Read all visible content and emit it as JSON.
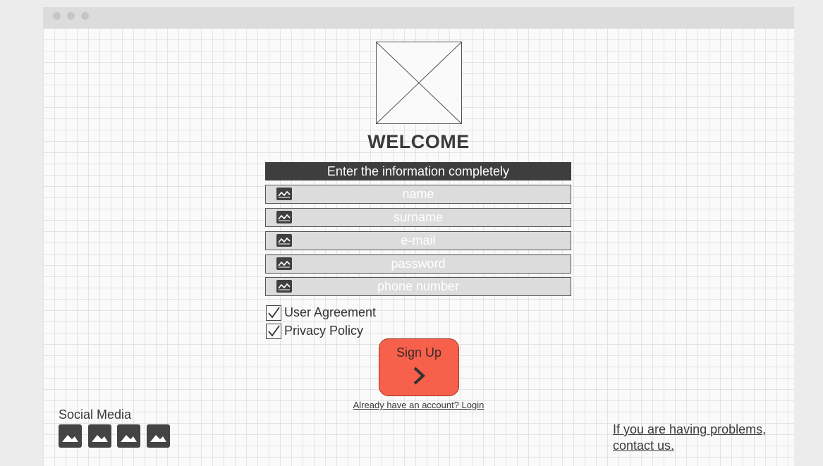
{
  "header": {
    "title": "WELCOME",
    "form_instruction": "Enter the information completely"
  },
  "form": {
    "fields": [
      {
        "name": "name",
        "placeholder": "name"
      },
      {
        "name": "surname",
        "placeholder": "surname"
      },
      {
        "name": "email",
        "placeholder": "e-mail"
      },
      {
        "name": "password",
        "placeholder": "password"
      },
      {
        "name": "phone",
        "placeholder": "phone number"
      }
    ],
    "checkboxes": [
      {
        "label": "User Agreement",
        "checked": true
      },
      {
        "label": "Privacy Policy",
        "checked": true
      }
    ],
    "signup_label": "Sign Up",
    "login_link": "Already have an account? Login"
  },
  "footer": {
    "social_heading": "Social Media",
    "social_icons": [
      "image-icon",
      "image-icon",
      "image-icon",
      "image-icon"
    ],
    "help_link": "If you are having problems, contact us."
  },
  "colors": {
    "accent": "#f7604a",
    "dark": "#3e3e3e",
    "field_bg": "#dcdcdc"
  }
}
